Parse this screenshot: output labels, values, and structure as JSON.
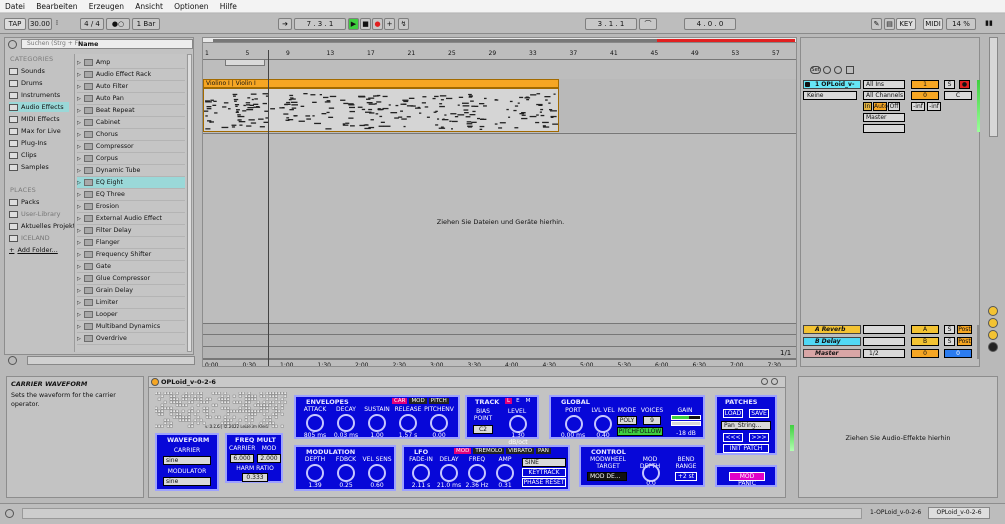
{
  "menu": [
    "Datei",
    "Bearbeiten",
    "Erzeugen",
    "Ansicht",
    "Optionen",
    "Hilfe"
  ],
  "transport": {
    "tap": "TAP",
    "tempo": "30.00",
    "signature": "4 / 4",
    "metronome": "●○",
    "quantize": "1 Bar",
    "position": "7 . 3 . 1",
    "loop_start": "3 . 1 . 1",
    "loop_length": "4 . 0 . 0",
    "key": "KEY",
    "midi": "MIDI",
    "cpu": "14 %"
  },
  "browser": {
    "search_placeholder": "Suchen (Strg + F)",
    "categories_title": "CATEGORIES",
    "categories": [
      "Sounds",
      "Drums",
      "Instruments",
      "Audio Effects",
      "MIDI Effects",
      "Max for Live",
      "Plug-Ins",
      "Clips",
      "Samples"
    ],
    "places_title": "PLACES",
    "places": [
      "Packs",
      "User-Library",
      "Aktuelles Projekt",
      "ICELAND",
      "Add Folder..."
    ],
    "name_header": "Name",
    "items": [
      "Amp",
      "Audio Effect Rack",
      "Auto Filter",
      "Auto Pan",
      "Beat Repeat",
      "Cabinet",
      "Chorus",
      "Compressor",
      "Corpus",
      "Dynamic Tube",
      "EQ Eight",
      "EQ Three",
      "Erosion",
      "External Audio Effect",
      "Filter Delay",
      "Flanger",
      "Frequency Shifter",
      "Gate",
      "Glue Compressor",
      "Grain Delay",
      "Limiter",
      "Looper",
      "Multiband Dynamics",
      "Overdrive"
    ],
    "selected": "EQ Eight"
  },
  "arrangement": {
    "ruler": [
      "1",
      "5",
      "9",
      "13",
      "17",
      "21",
      "25",
      "29",
      "33",
      "37",
      "41",
      "45",
      "49",
      "53",
      "57"
    ],
    "time_ruler": [
      "0:00",
      "0:30",
      "1:00",
      "1:30",
      "2:00",
      "2:30",
      "3:00",
      "3:30",
      "4:00",
      "4:30",
      "5:00",
      "5:30",
      "6:00",
      "6:30",
      "7:00",
      "7:30"
    ],
    "clip_name": "Violino I | Violin I",
    "drop_hint": "Ziehen Sie Dateien und Geräte hierhin.",
    "zoom": "1/1"
  },
  "mixer": {
    "set_label": "Set",
    "track1": {
      "name": "1 OPLoid_v-",
      "input": "All Ins",
      "channel": "All Channels",
      "monitor": [
        "In",
        "Auto",
        "Off"
      ],
      "output": "Master",
      "number": "1",
      "route": "Keine",
      "vol": "0",
      "pan": "C",
      "inf1": "-inf",
      "inf2": "-inf"
    },
    "returns": [
      {
        "name": "A Reverb",
        "letter": "A",
        "send": "S",
        "post": "Post",
        "color": "#f3c333"
      },
      {
        "name": "B Delay",
        "letter": "B",
        "send": "S",
        "post": "Post",
        "color": "#50d8f5"
      }
    ],
    "master": {
      "name": "Master",
      "fraction": "1/2",
      "vol": "0",
      "pan": "0"
    }
  },
  "info": {
    "title": "CARRIER WAVEFORM",
    "text": "Sets the waveform for the carrier operator."
  },
  "device": {
    "title": "OPLoid_v-0-2-6",
    "version_text": "v. 0.2.6 | © 2022 Leise im Klein",
    "waveform": {
      "title": "WAVEFORM",
      "carrier_label": "CARRIER",
      "carrier": "sine",
      "modulator_label": "MODULATOR",
      "modulator": "sine"
    },
    "freq_mult": {
      "title": "FREQ MULT",
      "carrier_label": "CARRIER",
      "mod_label": "MOD",
      "carrier": "6.000",
      "mod": "2.000",
      "harm_label": "HARM RATIO",
      "harm": "0.333"
    },
    "envelopes": {
      "title": "ENVELOPES",
      "tabs": [
        "CAR",
        "MOD",
        "PITCH"
      ],
      "knobs": [
        {
          "l": "ATTACK",
          "v": "805 ms"
        },
        {
          "l": "DECAY",
          "v": "0.03 ms"
        },
        {
          "l": "SUSTAIN",
          "v": "1.00"
        },
        {
          "l": "RELEASE",
          "v": "1.57 s"
        },
        {
          "l": "PITCHENV",
          "v": "0.00"
        }
      ]
    },
    "modulation": {
      "title": "MODULATION",
      "knobs": [
        {
          "l": "DEPTH",
          "v": "1.39"
        },
        {
          "l": "FDBCK",
          "v": "0.25"
        },
        {
          "l": "VEL SENS",
          "v": "0.60"
        }
      ]
    },
    "track": {
      "title": "TRACK",
      "tabs": [
        "L",
        "E",
        "M"
      ],
      "bias_label": "BIAS POINT",
      "bias": "C2",
      "level_label": "LEVEL",
      "level": "1.30 dB/oct"
    },
    "lfo": {
      "title": "LFO",
      "tabs": [
        "MOD",
        "TREMOLO",
        "VIBRATO",
        "PAN"
      ],
      "knobs": [
        {
          "l": "FADE-IN",
          "v": "2.11 s"
        },
        {
          "l": "DELAY",
          "v": "21.0 ms"
        },
        {
          "l": "FREQ",
          "v": "2.36 Hz"
        },
        {
          "l": "AMP",
          "v": "0.31"
        }
      ],
      "wave": "SINE",
      "keytrack": "KEYTRACK",
      "phase": "PHASE RESET"
    },
    "global": {
      "title": "GLOBAL",
      "port_label": "PORT",
      "port": "0.00 ms",
      "lvl_label": "LVL VEL",
      "lvl": "0.40",
      "mode_label": "MODE",
      "mode": "POLY",
      "voices_label": "VOICES",
      "voices": "9",
      "pitchfollow": "PITCHFOLLOW",
      "gain_label": "GAIN",
      "gain": "-18 dB"
    },
    "control": {
      "title": "CONTROL",
      "modwheel_label": "MODWHEEL TARGET",
      "modwheel": "MOD DE...",
      "depth_label": "MOD DEPTH",
      "depth": "0.0",
      "bend_label": "BEND RANGE",
      "bend": "+2 st"
    },
    "patches": {
      "title": "PATCHES",
      "load": "LOAD",
      "save": "SAVE",
      "preset": "Pan_String...",
      "prev": "<<<",
      "next": ">>>",
      "init": "INIT PATCH",
      "mod_panic": "MOD PANIC"
    }
  },
  "effects_drop": "Ziehen Sie Audio-Effekte hierhin",
  "status": {
    "tab1": "1-OPLoid_v-0-2-6",
    "tab2": "OPLoid_v-0-2-6"
  },
  "colors": {
    "accent": "#f6a623",
    "device_bg": "#0707d8",
    "selected_row": "#9ad8d8",
    "play": "#3fcf3f",
    "record": "#e22020"
  }
}
